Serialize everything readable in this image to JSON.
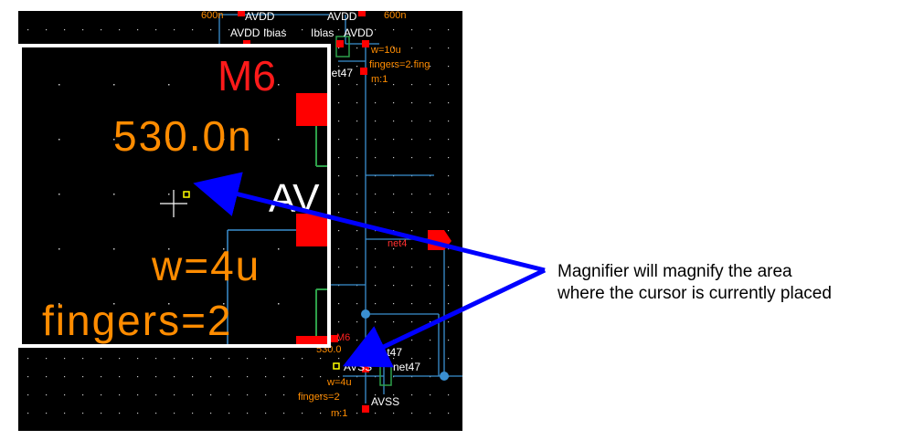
{
  "schematic": {
    "top_labels": {
      "left_size": "600n",
      "avdd_a": "AVDD",
      "avdd_b": "AVDD",
      "right_size": "600n",
      "avdd_c": "AVDD",
      "ibias_a": "Ibias",
      "ibias_b": "Ibias",
      "avdd_d": "AVDD"
    },
    "upper_device": {
      "width": "w=10u",
      "net": "net47",
      "fingers": "fingers=2 fing",
      "m": "m:1"
    },
    "net_right": "net4",
    "lower_device": {
      "name": "M6",
      "size": "530.0",
      "net_a": "net47",
      "avss_a": "AVSS",
      "net_b": "net47",
      "width": "w=4u",
      "fingers": "fingers=2",
      "avss_b": "AVSS",
      "m": "m:1"
    }
  },
  "magnifier": {
    "device_name": "M6",
    "size": "530.0n",
    "partial_pin": "AV",
    "width": "w=4u",
    "fingers": "fingers=2"
  },
  "callout": {
    "line1": "Magnifier will magnify the area",
    "line2": "where the cursor is currently placed"
  },
  "colors": {
    "background": "#000000",
    "wire": "#3a8fd0",
    "pin": "#ff0000",
    "label_orange": "#ff8c00",
    "label_white": "#ffffff",
    "label_yellow": "#ffff00",
    "arrow": "#0000ff"
  }
}
